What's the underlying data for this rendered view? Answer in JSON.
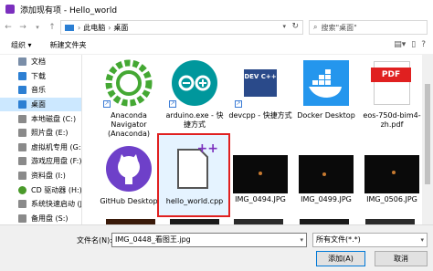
{
  "window": {
    "title": "添加现有项 - Hello_world"
  },
  "address": {
    "crumbs": [
      "此电脑",
      "桌面"
    ],
    "search_placeholder": "搜索\"桌面\""
  },
  "toolbar": {
    "organize": "组织 ▾",
    "new_folder": "新建文件夹"
  },
  "sidebar": {
    "items": [
      {
        "label": "文档",
        "icon": "document-icon",
        "color": "#7a8ea8"
      },
      {
        "label": "下载",
        "icon": "download-icon",
        "color": "#2c7fd3"
      },
      {
        "label": "音乐",
        "icon": "music-icon",
        "color": "#2c7fd3"
      },
      {
        "label": "桌面",
        "icon": "desktop-icon",
        "color": "#2c7fd3"
      },
      {
        "label": "本地磁盘 (C:)",
        "icon": "drive-icon",
        "color": "#8a8a8a"
      },
      {
        "label": "照片盘 (E:)",
        "icon": "drive-icon",
        "color": "#8a8a8a"
      },
      {
        "label": "虚拟机专用 (G:)",
        "icon": "drive-icon",
        "color": "#8a8a8a"
      },
      {
        "label": "游戏应用盘 (F:)",
        "icon": "drive-icon",
        "color": "#8a8a8a"
      },
      {
        "label": "资料盘 (I:)",
        "icon": "drive-icon",
        "color": "#8a8a8a"
      },
      {
        "label": "CD 驱动器 (H:)",
        "icon": "cd-drive-icon",
        "color": "#4a9a2a"
      },
      {
        "label": "系统快速启动 (J:)",
        "icon": "drive-icon",
        "color": "#8a8a8a"
      },
      {
        "label": "备用盘 (S:)",
        "icon": "drive-icon",
        "color": "#8a8a8a"
      }
    ],
    "selected_index": 3
  },
  "files": [
    {
      "label": "Anaconda Navigator (Anaconda)",
      "icon": "anaconda-icon"
    },
    {
      "label": "arduino.exe - 快捷方式",
      "icon": "arduino-icon"
    },
    {
      "label": "devcpp - 快捷方式",
      "icon": "devcpp-icon",
      "icon_text": "DEV C++"
    },
    {
      "label": "Docker Desktop",
      "icon": "docker-icon"
    },
    {
      "label": "eos-750d-bim4-zh.pdf",
      "icon": "pdf-icon",
      "icon_text": "PDF"
    },
    {
      "label": "GitHub Desktop",
      "icon": "github-icon"
    },
    {
      "label": "hello_world.cpp",
      "icon": "cpp-file-icon",
      "icon_text": "++"
    },
    {
      "label": "IMG_0494.JPG",
      "icon": "photo-thumbnail"
    },
    {
      "label": "IMG_0499.JPG",
      "icon": "photo-thumbnail"
    },
    {
      "label": "IMG_0506.JPG",
      "icon": "photo-thumbnail"
    }
  ],
  "footer": {
    "filename_label": "文件名(N):",
    "filename_value": "IMG_0448_看图王.jpg",
    "filter_value": "所有文件(*.*)",
    "add_button": "添加(A)",
    "cancel_button": "取消"
  },
  "colors": {
    "accent": "#0078d7",
    "selection_fill": "#cce8ff",
    "highlight_box": "#e02020"
  }
}
